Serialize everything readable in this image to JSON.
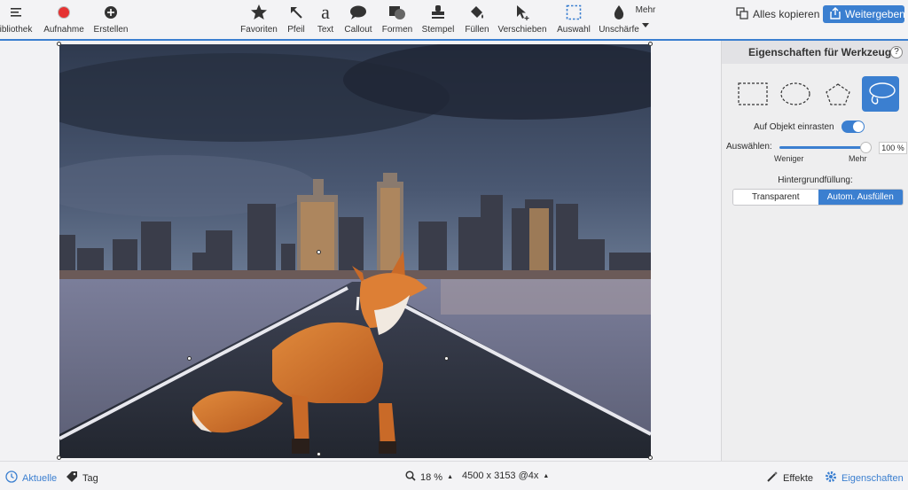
{
  "toolbar": {
    "left": [
      {
        "label": "ibliothek",
        "icon": "menu-icon"
      },
      {
        "label": "Aufnahme",
        "icon": "record-icon"
      },
      {
        "label": "Erstellen",
        "icon": "add-icon"
      }
    ],
    "tools": [
      {
        "label": "Favoriten",
        "icon": "star-icon"
      },
      {
        "label": "Pfeil",
        "icon": "arrow-icon"
      },
      {
        "label": "Text",
        "icon": "text-icon"
      },
      {
        "label": "Callout",
        "icon": "callout-icon"
      },
      {
        "label": "Formen",
        "icon": "shapes-icon"
      },
      {
        "label": "Stempel",
        "icon": "stamp-icon"
      },
      {
        "label": "Füllen",
        "icon": "fill-icon"
      },
      {
        "label": "Verschieben",
        "icon": "move-icon"
      },
      {
        "label": "Auswahl",
        "icon": "selection-icon"
      },
      {
        "label": "Unschärfe",
        "icon": "blur-icon"
      }
    ],
    "more_label": "Mehr",
    "copy_all_label": "Alles kopieren",
    "share_label": "Weitergeben"
  },
  "panel": {
    "title": "Eigenschaften für Werkzeuge",
    "help": "?",
    "shapes": [
      "rectangle-select-icon",
      "ellipse-select-icon",
      "polygon-select-icon",
      "lasso-select-icon"
    ],
    "snap_label": "Auf Objekt einrasten",
    "select_label": "Auswählen:",
    "select_value": "100 %",
    "less_label": "Weniger",
    "more_label": "Mehr",
    "bg_fill_label": "Hintergrundfüllung:",
    "bg_options": [
      "Transparent",
      "Autom. Ausfüllen"
    ],
    "accent": "#3b7fd0"
  },
  "status": {
    "recent_label": "Aktuelle",
    "tag_label": "Tag",
    "zoom": "18 %",
    "dimensions": "4500 x 3153 @4x",
    "effects_label": "Effekte",
    "properties_label": "Eigenschaften"
  }
}
